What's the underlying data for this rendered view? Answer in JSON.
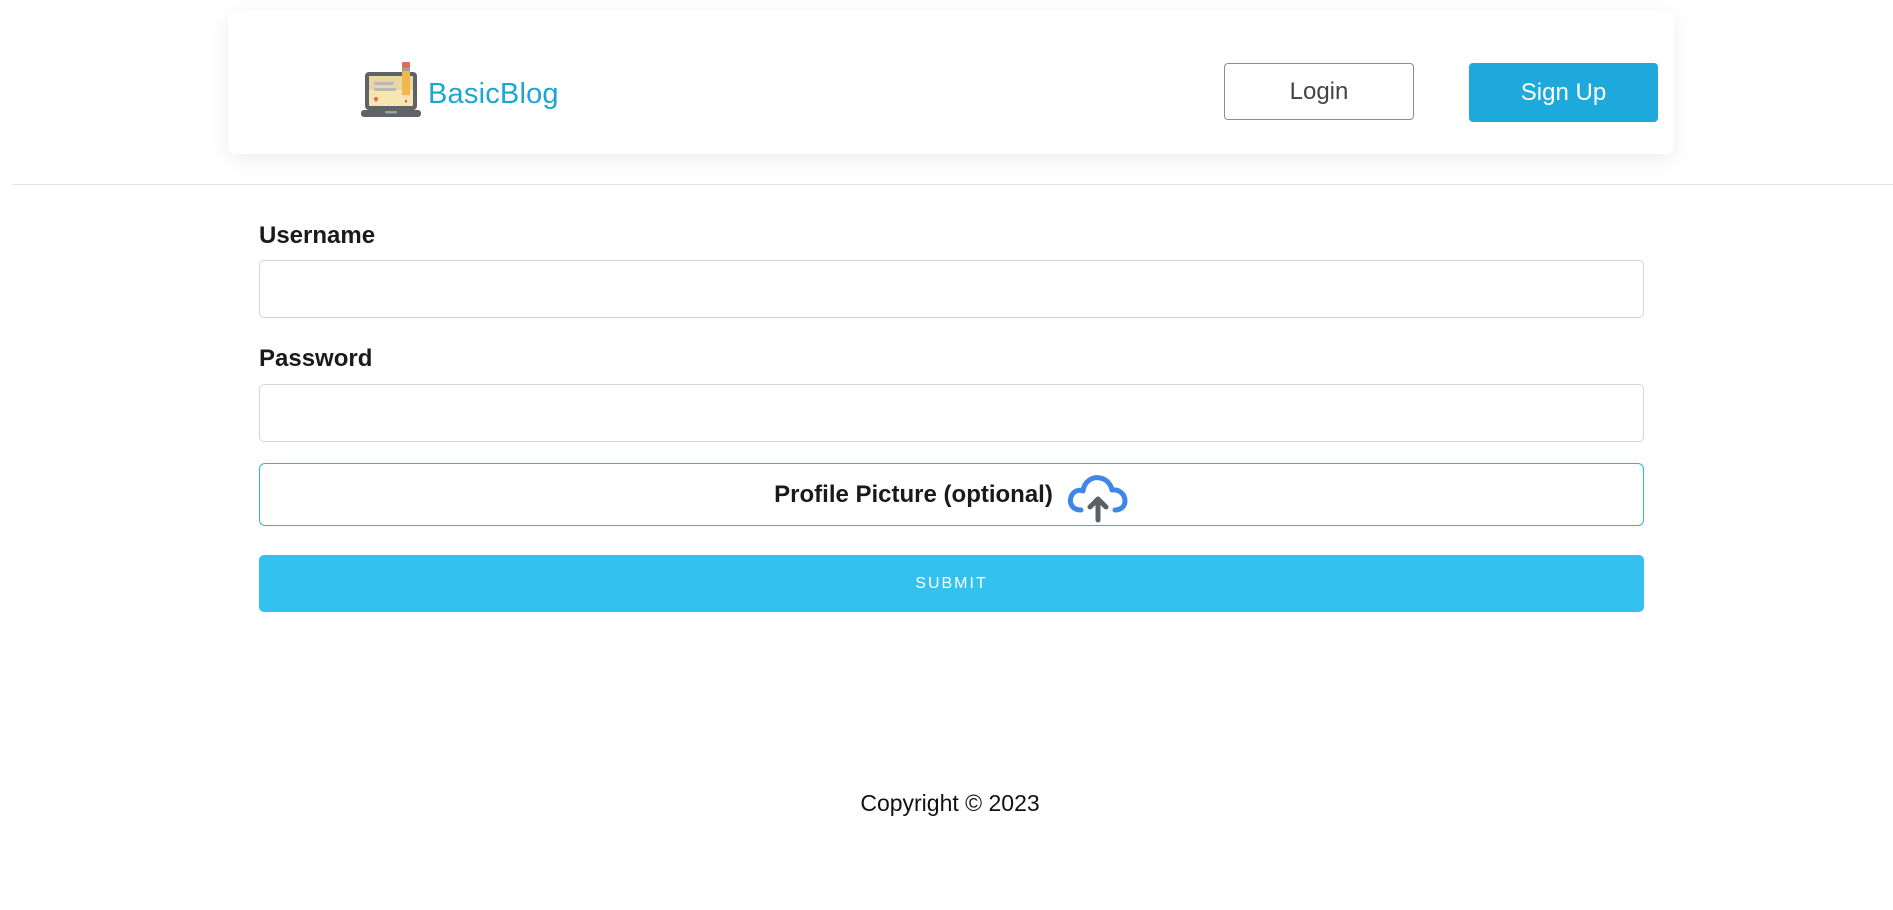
{
  "header": {
    "brand_name": "BasicBlog",
    "logo_icon": "laptop-pencil-icon",
    "login_label": "Login",
    "signup_label": "Sign Up"
  },
  "form": {
    "username_label": "Username",
    "username_value": "",
    "password_label": "Password",
    "password_value": "",
    "profile_picture_label": "Profile Picture (optional)",
    "upload_icon": "cloud-upload-icon",
    "submit_label": "SUBMIT"
  },
  "footer": {
    "copyright": "Copyright © 2023"
  },
  "colors": {
    "brand": "#1ea6d3",
    "signup_button": "#1ea9dc",
    "submit_button": "#33c2ef",
    "upload_border": "#2fb3df"
  }
}
